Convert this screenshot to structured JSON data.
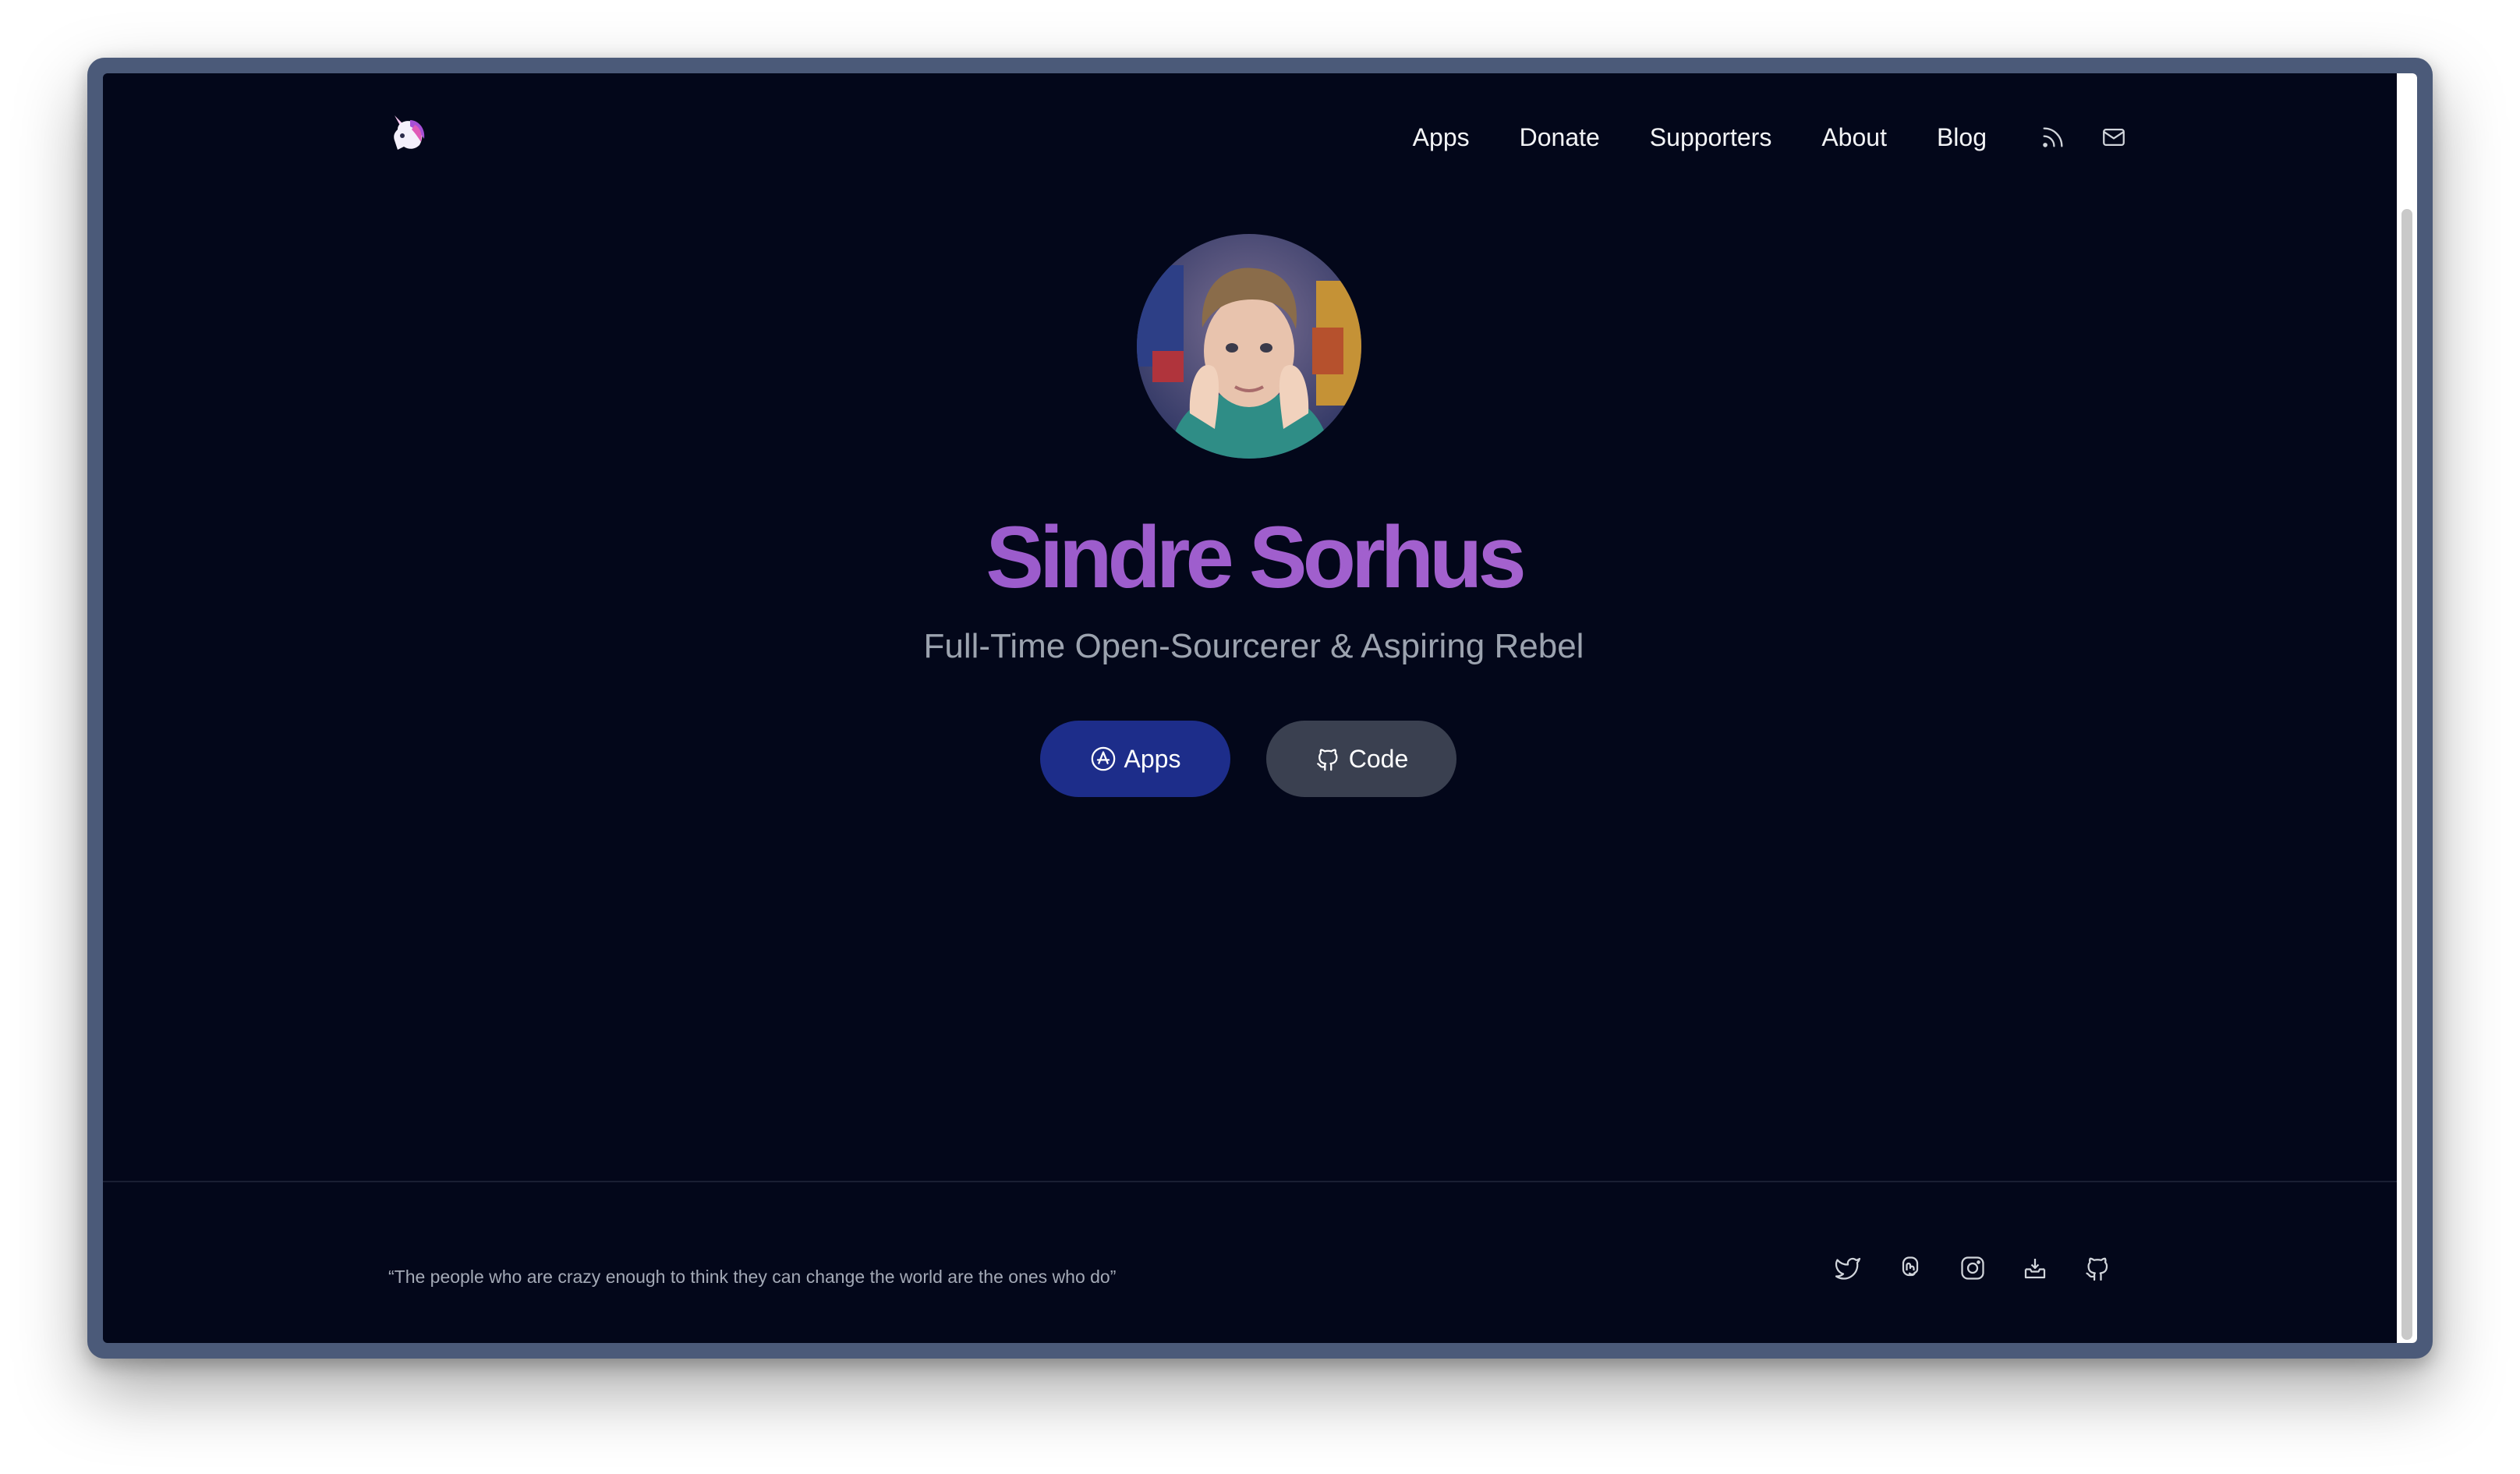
{
  "header": {
    "logo": "unicorn-icon",
    "nav": [
      {
        "label": "Apps"
      },
      {
        "label": "Donate"
      },
      {
        "label": "Supporters"
      },
      {
        "label": "About"
      },
      {
        "label": "Blog"
      }
    ],
    "nav_icons": [
      "rss-icon",
      "mail-icon"
    ]
  },
  "hero": {
    "avatar": "profile-photo",
    "name": "Sindre Sorhus",
    "tagline": "Full-Time Open-Sourcerer & Aspiring Rebel",
    "buttons": {
      "apps_label": "Apps",
      "apps_icon": "app-store-icon",
      "code_label": "Code",
      "code_icon": "github-icon"
    }
  },
  "footer": {
    "quote": "“The people who are crazy enough to think they can change the world are the ones who do”",
    "social_icons": [
      "twitter-icon",
      "mastodon-icon",
      "instagram-icon",
      "product-hunt-icon",
      "github-icon"
    ]
  },
  "colors": {
    "background": "#03071a",
    "name_gradient_start": "#8c52c8",
    "name_gradient_end": "#b36bd2",
    "apps_button": "#1d2d8a",
    "code_button": "#3a4050",
    "tagline": "#9ca3af"
  }
}
